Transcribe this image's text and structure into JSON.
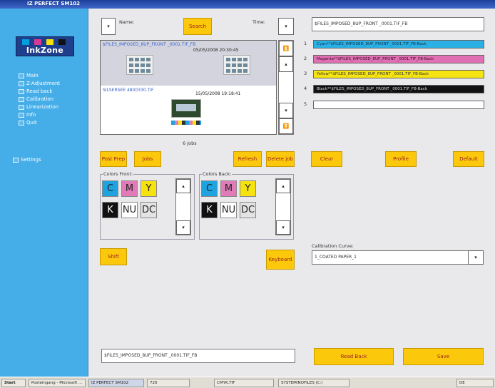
{
  "window": {
    "title": "IZ PERFECT SM102"
  },
  "sidebar": {
    "logo": {
      "text": "InkZone",
      "colors": [
        "#00a0e0",
        "#d63a96",
        "#f5e10c",
        "#111111"
      ]
    },
    "nav": [
      {
        "label": "Main",
        "icon": "home-icon"
      },
      {
        "label": "Z-Adjustment",
        "icon": "adjust-icon"
      },
      {
        "label": "Read back",
        "icon": "read-back-icon"
      },
      {
        "label": "Calibration",
        "icon": "calibration-icon"
      },
      {
        "label": "Linearization",
        "icon": "linearization-icon"
      },
      {
        "label": "Info",
        "icon": "info-icon"
      },
      {
        "label": "Quit",
        "icon": "quit-icon"
      }
    ],
    "settings": {
      "label": "Settings",
      "icon": "settings-icon"
    }
  },
  "search": {
    "name_label": "Name:",
    "time_label": "Time:",
    "search_button": "Search",
    "name_dropdown_icon": "chevron-down-icon",
    "time_dropdown_icon": "chevron-down-icon"
  },
  "jobs": {
    "items": [
      {
        "name": "$FILES_IMPOSED_8UP_FRONT _0001.TIF_FB",
        "date": "05/05/2008 20:30:45",
        "selected": true
      },
      {
        "name": "SILSERSEE 4800330.TIF",
        "date": "15/05/2008 19:18:41",
        "selected": false
      }
    ],
    "count_label": "6 Jobs"
  },
  "actions": {
    "post_prep": "Post Prep",
    "jobs": "Jobs",
    "refresh": "Refresh",
    "delete_job": "Delete job",
    "clear": "Clear",
    "profile": "Profile",
    "default": "Default",
    "shift": "Shift",
    "keyboard": "Keyboard",
    "read_back": "Read Back",
    "save": "Save"
  },
  "colors_front": {
    "title": "Colors Front:",
    "swatches": [
      "C",
      "M",
      "Y",
      "K",
      "NU",
      "DC"
    ]
  },
  "colors_back": {
    "title": "Colors Back:",
    "swatches": [
      "C",
      "M",
      "Y",
      "K",
      "NU",
      "DC"
    ]
  },
  "swatch_colors": {
    "C": "#1fa3e0",
    "M": "#e07bb8",
    "Y": "#f5e20f",
    "K": "#111111",
    "NU": "#ffffff",
    "DC": "#e3e3e3"
  },
  "top_file": "$FILES_IMPOSED_8UP_FRONT _0001.TIF_FB",
  "channels": [
    {
      "num": "1",
      "text": "Cyan**$FILES_IMPOSED_8UP_FRONT _0001.TIF_FB-Back",
      "bg": "#2bb0e6",
      "fg": "#103040"
    },
    {
      "num": "2",
      "text": "Magenta**$FILES_IMPOSED_8UP_FRONT _0001.TIF_FB-Back",
      "bg": "#e06fb3",
      "fg": "#3a0f28"
    },
    {
      "num": "3",
      "text": "Yellow**$FILES_IMPOSED_8UP_FRONT _0001.TIF_FB-Back",
      "bg": "#f6e412",
      "fg": "#333333"
    },
    {
      "num": "4",
      "text": "Black**$FILES_IMPOSED_8UP_FRONT _0001.TIF_FB-Back",
      "bg": "#111111",
      "fg": "#dddddd"
    },
    {
      "num": "5",
      "text": "",
      "bg": "#ffffff",
      "fg": "#333333"
    }
  ],
  "calibration": {
    "label": "Calibration Curve:",
    "value": "1_COATED PAPER_1"
  },
  "bottom_file": "$FILES_IMPOSED_8UP_FRONT _0001.TIF_FB",
  "taskbar": {
    "start": "Start",
    "tasks": [
      "Posteingang - Microsoft ...",
      "IZ PERFECT SM102",
      "720",
      "CMYK.TIF",
      "SYSTEMINOFILES (C:)"
    ],
    "clock": "DE"
  }
}
